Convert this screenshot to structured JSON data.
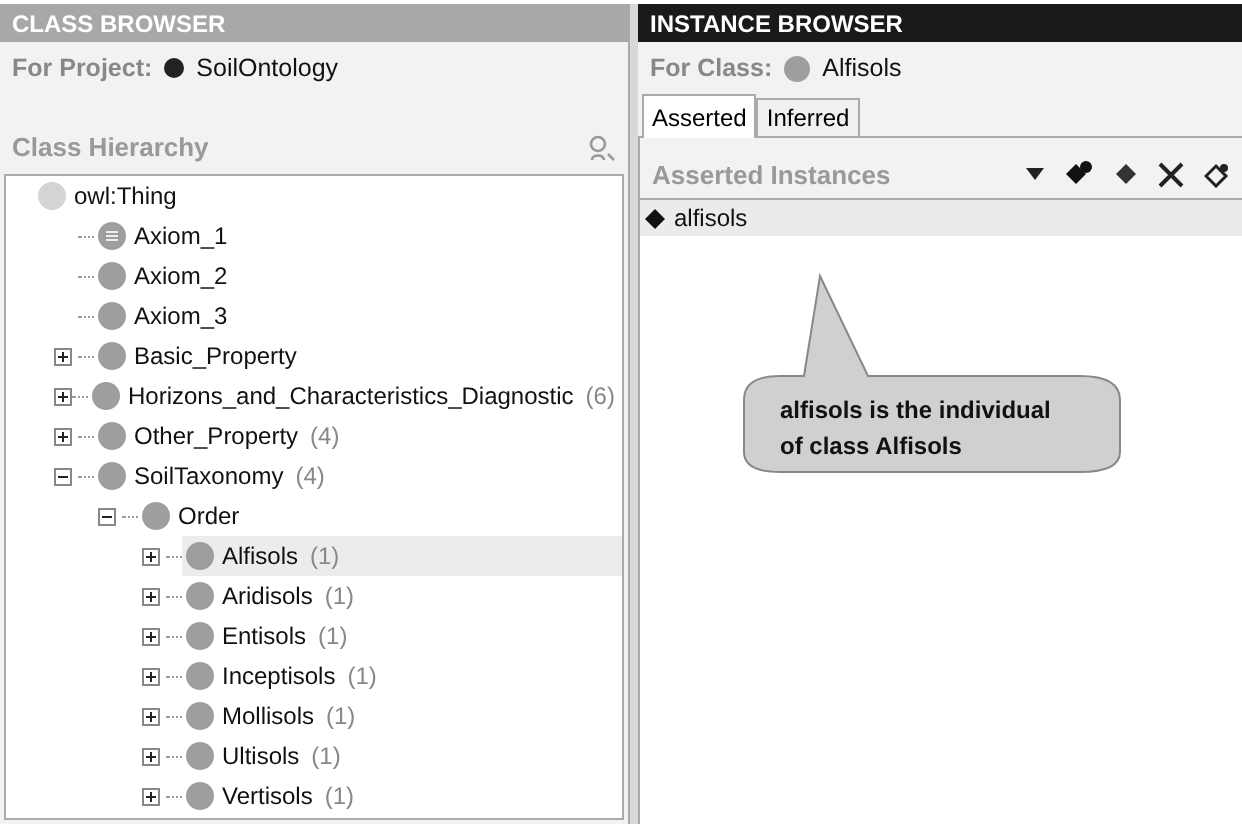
{
  "class_browser": {
    "title": "CLASS BROWSER",
    "project_label": "For Project:",
    "project_name": "SoilOntology",
    "hierarchy_label": "Class Hierarchy",
    "tree": [
      {
        "label": "owl:Thing",
        "kind": "root",
        "selected": false,
        "children": [
          {
            "label": "Axiom_1",
            "kind": "defined",
            "selected": false
          },
          {
            "label": "Axiom_2",
            "kind": "primitive",
            "selected": false
          },
          {
            "label": "Axiom_3",
            "kind": "primitive",
            "selected": false
          },
          {
            "label": "Basic_Property",
            "kind": "primitive",
            "selected": false,
            "expanded": false
          },
          {
            "label": "Horizons_and_Characteristics_Diagnostic",
            "count": "(6)",
            "kind": "primitive",
            "selected": false,
            "expanded": false
          },
          {
            "label": "Other_Property",
            "count": "(4)",
            "kind": "primitive",
            "selected": false,
            "expanded": false
          },
          {
            "label": "SoilTaxonomy",
            "count": "(4)",
            "kind": "primitive",
            "selected": false,
            "expanded": true,
            "children": [
              {
                "label": "Order",
                "kind": "primitive",
                "selected": false,
                "expanded": true,
                "children": [
                  {
                    "label": "Alfisols",
                    "count": "(1)",
                    "kind": "primitive",
                    "selected": true,
                    "expanded": false
                  },
                  {
                    "label": "Aridisols",
                    "count": "(1)",
                    "kind": "primitive",
                    "selected": false,
                    "expanded": false
                  },
                  {
                    "label": "Entisols",
                    "count": "(1)",
                    "kind": "primitive",
                    "selected": false,
                    "expanded": false
                  },
                  {
                    "label": "Inceptisols",
                    "count": "(1)",
                    "kind": "primitive",
                    "selected": false,
                    "expanded": false
                  },
                  {
                    "label": "Mollisols",
                    "count": "(1)",
                    "kind": "primitive",
                    "selected": false,
                    "expanded": false
                  },
                  {
                    "label": "Ultisols",
                    "count": "(1)",
                    "kind": "primitive",
                    "selected": false,
                    "expanded": false
                  },
                  {
                    "label": "Vertisols",
                    "count": "(1)",
                    "kind": "primitive",
                    "selected": false,
                    "expanded": false
                  }
                ]
              }
            ]
          }
        ]
      }
    ]
  },
  "instance_browser": {
    "title": "INSTANCE BROWSER",
    "class_label": "For Class:",
    "class_name": "Alfisols",
    "tabs": [
      {
        "label": "Asserted",
        "selected": true
      },
      {
        "label": "Inferred",
        "selected": false
      }
    ],
    "instances_label": "Asserted Instances",
    "instances": [
      {
        "label": "alfisols",
        "selected": true
      }
    ],
    "callout": "alfisols is the individual of class Alfisols"
  }
}
